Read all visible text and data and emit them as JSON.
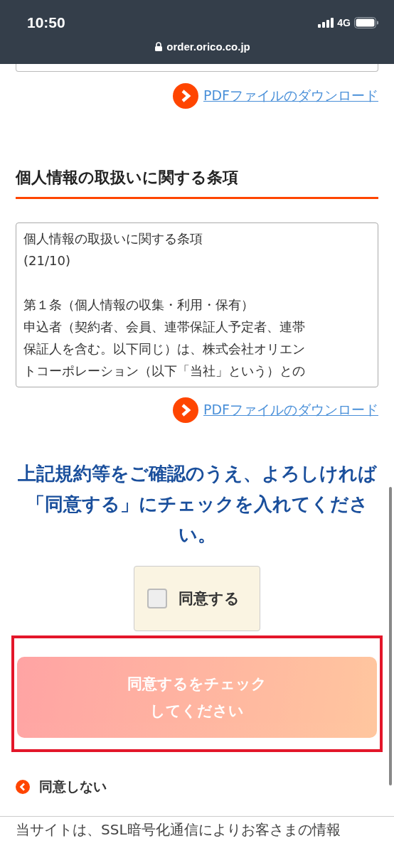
{
  "status_bar": {
    "time": "10:50",
    "network": "4G",
    "url": "order.orico.co.jp"
  },
  "top_link": {
    "label": "PDFファイルのダウンロード"
  },
  "section": {
    "heading": "個人情報の取扱いに関する条項",
    "terms_paragraphs": [
      [
        "個人情報の取扱いに関する条項",
        "(21/10)"
      ],
      [
        "第１条（個人情報の収集・利用・保有）",
        "申込者（契約者、会員、連帯保証人予定者、連帯",
        "保証人を含む。以下同じ）は、株式会社オリエン",
        "トコーポレーション（以下「当社」という）との"
      ]
    ],
    "pdf_link": {
      "label": "PDFファイルのダウンロード"
    }
  },
  "notice": "上記規約等をご確認のうえ、よろしければ「同意する」にチェックを入れてください。",
  "agree": {
    "label": "同意する",
    "checked": false
  },
  "submit": {
    "label_lines": [
      "同意するをチェック",
      "してください"
    ],
    "disabled": true,
    "highlighted": true
  },
  "decline": {
    "label": "同意しない"
  },
  "footer": {
    "text": "当サイトは、SSL暗号化通信によりお客さまの情報"
  }
}
